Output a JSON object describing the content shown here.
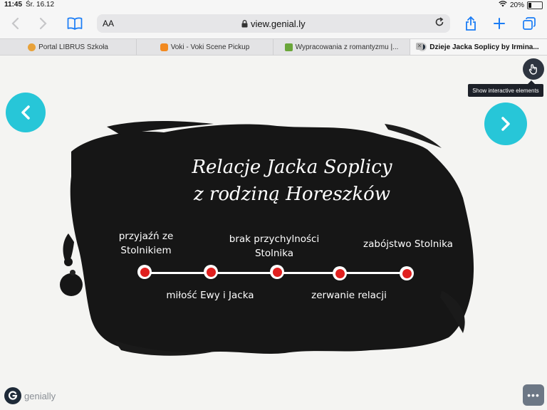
{
  "status": {
    "time": "11:45",
    "date": "Śr. 16.12",
    "battery": "20%"
  },
  "browser": {
    "text_size_label": "AA",
    "url": "view.genial.ly",
    "tabs": [
      {
        "label": "Portal LIBRUS Szkoła",
        "favicon_color": "#e8a23a"
      },
      {
        "label": "Voki - Voki Scene Pickup",
        "favicon_color": "#f28a20"
      },
      {
        "label": "Wypracowania z romantyzmu |...",
        "favicon_color": "#6aa63a"
      },
      {
        "label": "Dzieje Jacka Soplicy by Irmina...",
        "favicon_color": "#1e2a38"
      }
    ]
  },
  "slide": {
    "title_line1": "Relacje Jacka Soplicy",
    "title_line2": "z rodziną Horeszków",
    "tooltip": "Show interactive elements",
    "events_top": [
      {
        "text_l1": "przyjaźń ze",
        "text_l2": "Stolnikiem"
      },
      {
        "text_l1": "brak przychylności",
        "text_l2": "Stolnika"
      },
      {
        "text_l1": "zabójstwo Stolnika",
        "text_l2": ""
      }
    ],
    "events_bottom": [
      {
        "text": "miłość Ewy i Jacka"
      },
      {
        "text": "zerwanie relacji"
      }
    ],
    "accent_color": "#27c6d8",
    "dot_color": "#e0201f"
  },
  "footer": {
    "brand": "genially"
  }
}
